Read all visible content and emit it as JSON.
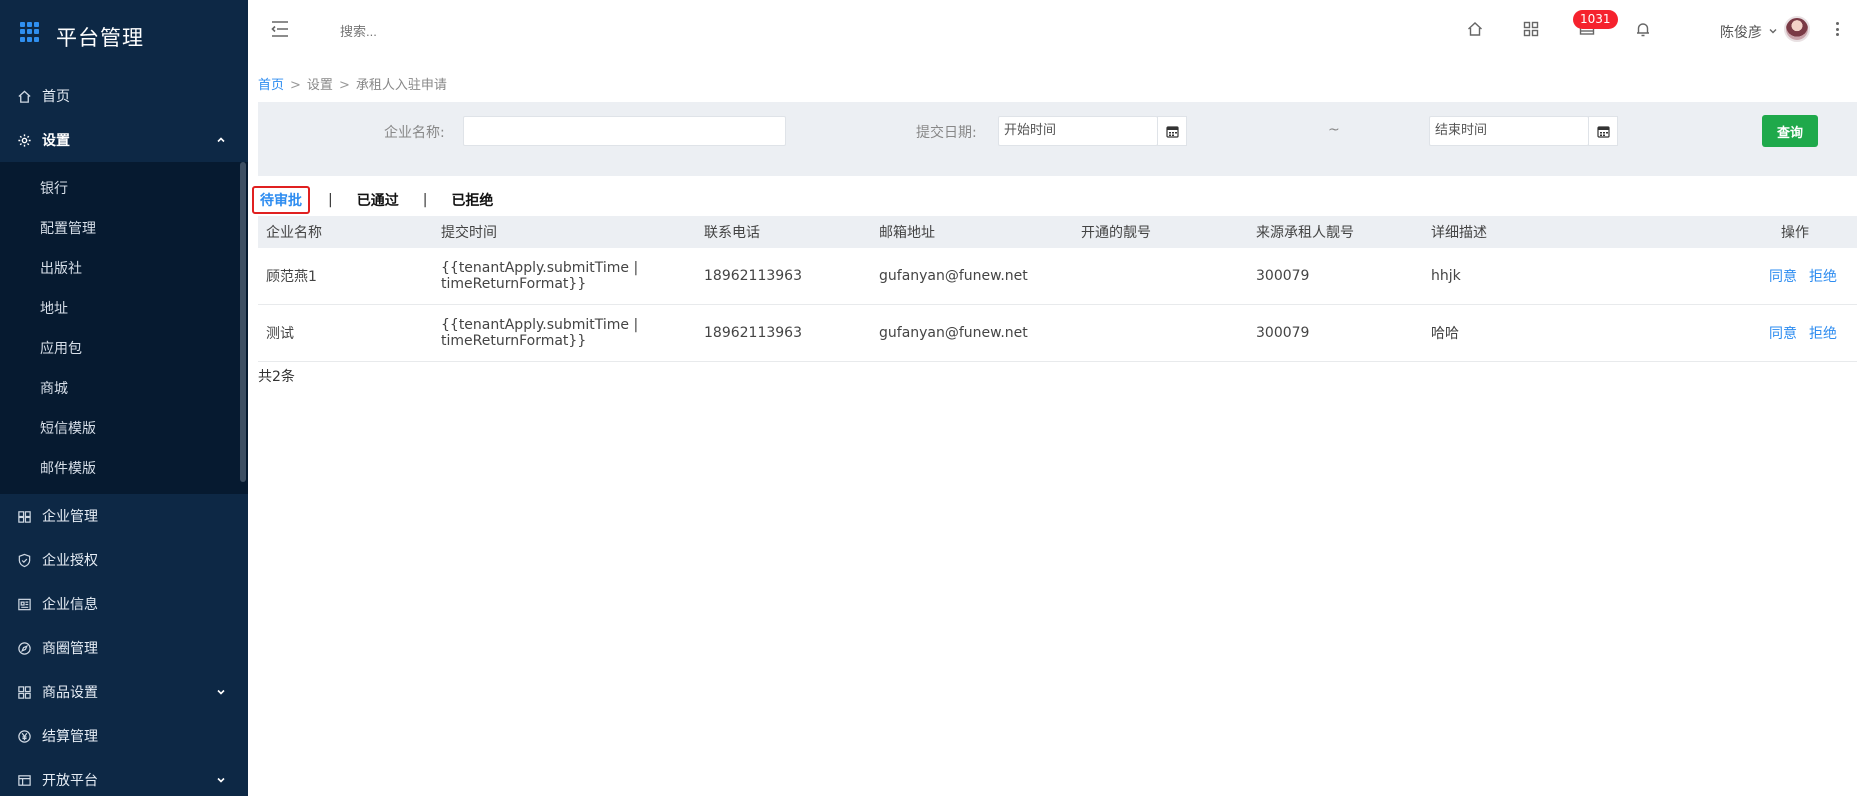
{
  "app": {
    "title": "平台管理"
  },
  "sidebar": {
    "top_items": [
      {
        "label": "首页",
        "icon": "home-icon"
      },
      {
        "label": "设置",
        "icon": "gear-icon"
      }
    ],
    "settings_sub": [
      "银行",
      "配置管理",
      "出版社",
      "地址",
      "应用包",
      "商城",
      "短信模版",
      "邮件模版"
    ],
    "bottom_items": [
      {
        "label": "企业管理",
        "icon": "cube-icon"
      },
      {
        "label": "企业授权",
        "icon": "shield-icon"
      },
      {
        "label": "企业信息",
        "icon": "newspaper-icon"
      },
      {
        "label": "商圈管理",
        "icon": "compass-icon"
      },
      {
        "label": "商品设置",
        "icon": "grid-icon"
      },
      {
        "label": "结算管理",
        "icon": "yen-icon"
      },
      {
        "label": "开放平台",
        "icon": "table-icon"
      }
    ]
  },
  "header": {
    "search_placeholder": "搜索...",
    "badge_count": "1031",
    "user_name": "陈俊彦"
  },
  "breadcrumb": {
    "home": "首页",
    "sep1": ">",
    "level2": "设置",
    "sep2": ">",
    "current": "承租人入驻申请"
  },
  "filter": {
    "company_label": "企业名称:",
    "company_value": "",
    "date_label": "提交日期:",
    "start_placeholder": "开始时间",
    "tilde": "~",
    "end_placeholder": "结束时间",
    "query_label": "查询"
  },
  "tabs": {
    "pending": "待审批",
    "sep": "|",
    "approved": "已通过",
    "rejected": "已拒绝"
  },
  "table": {
    "headers": [
      "企业名称",
      "提交时间",
      "联系电话",
      "邮箱地址",
      "开通的靓号",
      "来源承租人靓号",
      "详细描述",
      "操作"
    ],
    "rows": [
      {
        "company": "顾范燕1",
        "time": "{{tenantApply.submitTime | timeReturnFormat}}",
        "phone": "18962113963",
        "email": "gufanyan@funew.net",
        "number": "",
        "source": "300079",
        "desc": "hhjk",
        "agree": "同意",
        "reject": "拒绝"
      },
      {
        "company": "测试",
        "time": "{{tenantApply.submitTime | timeReturnFormat}}",
        "phone": "18962113963",
        "email": "gufanyan@funew.net",
        "number": "",
        "source": "300079",
        "desc": "哈哈",
        "agree": "同意",
        "reject": "拒绝"
      }
    ],
    "total": "共2条"
  }
}
